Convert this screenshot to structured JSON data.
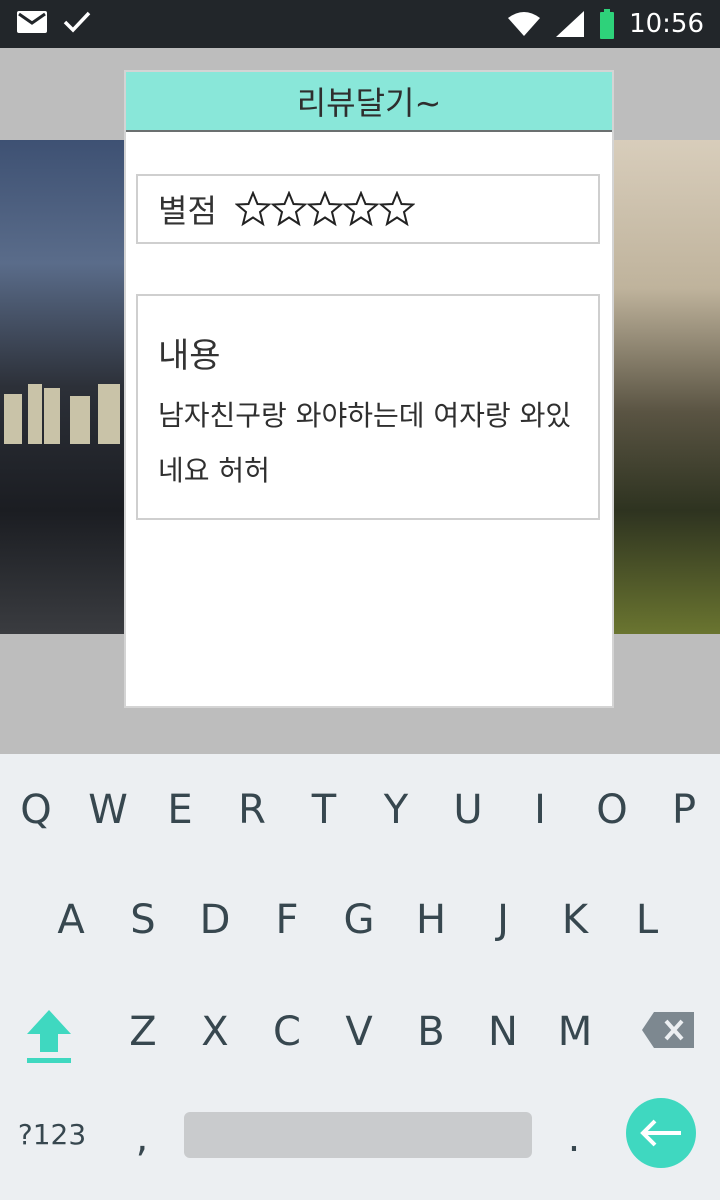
{
  "status_bar": {
    "time": "10:56",
    "icons": [
      "mail-icon",
      "check-icon",
      "wifi-icon",
      "signal-icon",
      "battery-icon"
    ]
  },
  "dialog": {
    "title": "리뷰달기~",
    "rating_label": "별점",
    "rating_value": 0,
    "rating_max": 5,
    "content_label": "내용",
    "content_text": "남자친구랑 와야하는데 여자랑 와있네요 허허"
  },
  "keyboard": {
    "row1": [
      "Q",
      "W",
      "E",
      "R",
      "T",
      "Y",
      "U",
      "I",
      "O",
      "P"
    ],
    "row2": [
      "A",
      "S",
      "D",
      "F",
      "G",
      "H",
      "J",
      "K",
      "L"
    ],
    "row3": [
      "Z",
      "X",
      "C",
      "V",
      "B",
      "N",
      "M"
    ],
    "symbols_key": "?123",
    "comma_key": ",",
    "period_key": ".",
    "accent_color": "#3fd8c0"
  },
  "colors": {
    "dialog_header": "#89e7d9",
    "status_bar": "#22262a"
  }
}
